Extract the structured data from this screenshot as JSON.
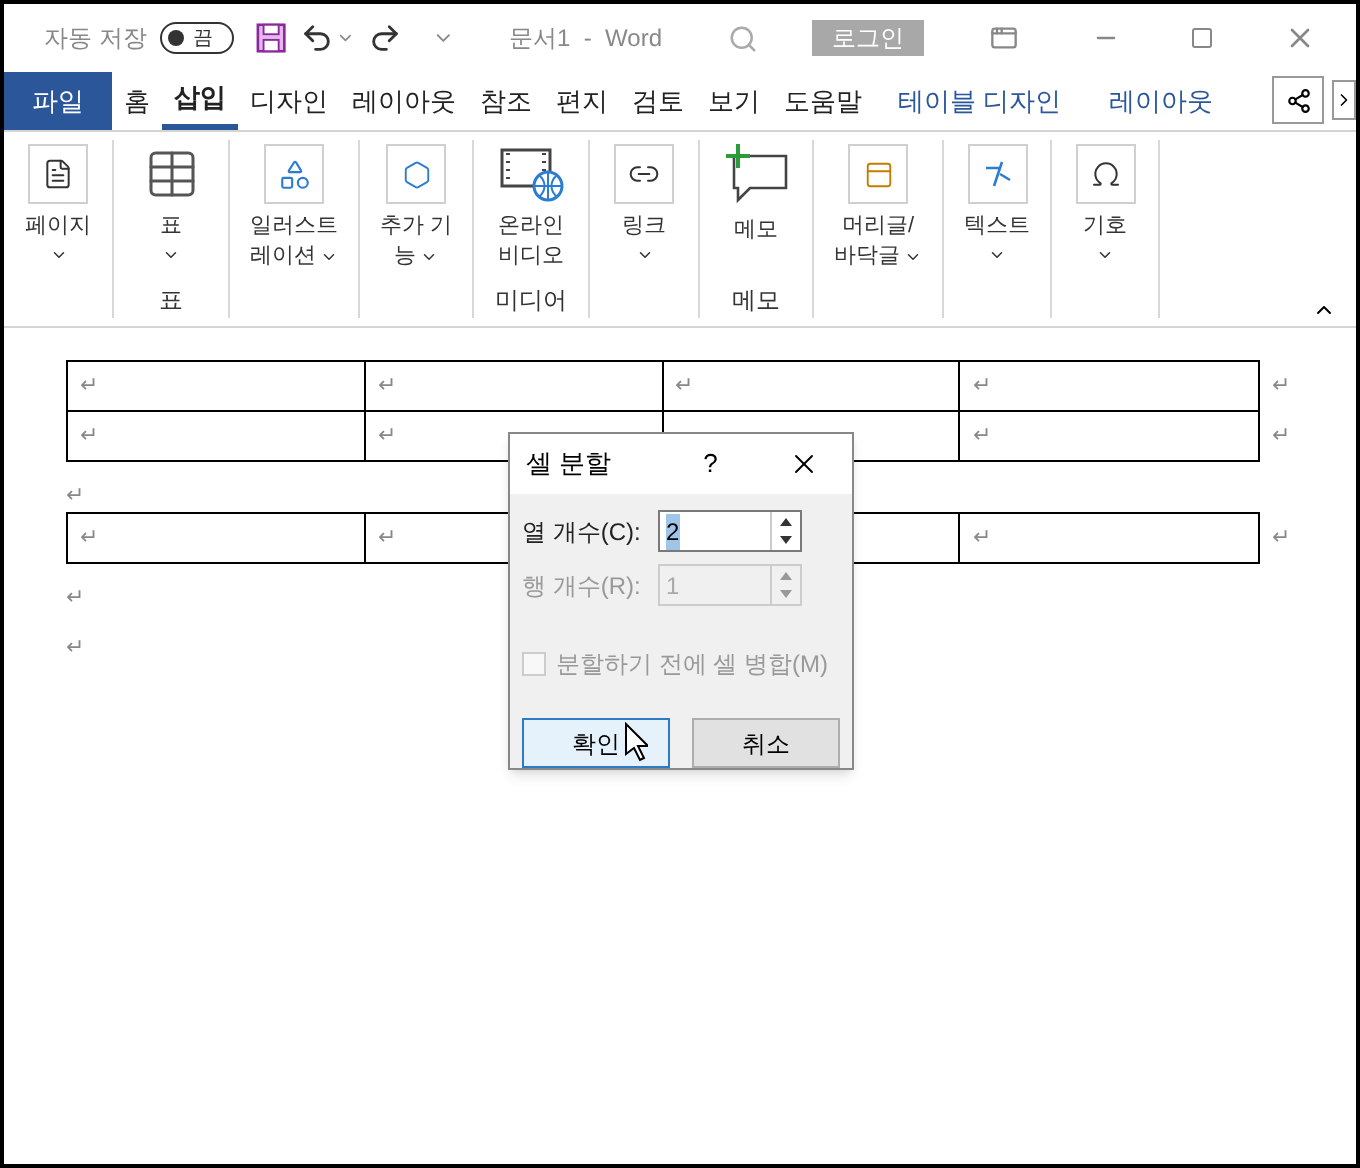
{
  "title_bar": {
    "autosave_label": "자동 저장",
    "autosave_state": "끔",
    "autosave_on": false,
    "document_title": "문서1  -  Word",
    "login_button": "로그인"
  },
  "tabs": [
    {
      "label": "파일",
      "kind": "file",
      "selected": false
    },
    {
      "label": "홈",
      "kind": "normal",
      "selected": false
    },
    {
      "label": "삽입",
      "kind": "normal",
      "selected": true
    },
    {
      "label": "디자인",
      "kind": "normal",
      "selected": false
    },
    {
      "label": "레이아웃",
      "kind": "normal",
      "selected": false
    },
    {
      "label": "참조",
      "kind": "normal",
      "selected": false
    },
    {
      "label": "편지",
      "kind": "normal",
      "selected": false
    },
    {
      "label": "검토",
      "kind": "normal",
      "selected": false
    },
    {
      "label": "보기",
      "kind": "normal",
      "selected": false
    },
    {
      "label": "도움말",
      "kind": "normal",
      "selected": false
    },
    {
      "label": "테이블 디자인",
      "kind": "context",
      "selected": false
    },
    {
      "label": "레이아웃",
      "kind": "context",
      "selected": false
    }
  ],
  "ribbon_groups": [
    {
      "button": {
        "kind": "page",
        "lines": [
          "페이지"
        ],
        "dropdown": true
      }
    },
    {
      "label": "표",
      "button": {
        "kind": "table",
        "lines": [
          "표"
        ],
        "dropdown": true
      }
    },
    {
      "button": {
        "kind": "shapes",
        "lines": [
          "일러스트",
          "레이션"
        ],
        "dropdown": true
      }
    },
    {
      "button": {
        "kind": "addin",
        "lines": [
          "추가 기",
          "능"
        ],
        "dropdown": true
      }
    },
    {
      "label": "미디어",
      "button": {
        "kind": "video",
        "lines": [
          "온라인",
          "비디오"
        ],
        "dropdown": false
      }
    },
    {
      "button": {
        "kind": "link",
        "lines": [
          "링크"
        ],
        "dropdown": true
      }
    },
    {
      "label": "메모",
      "button": {
        "kind": "comment",
        "lines": [
          "메모"
        ],
        "dropdown": false
      }
    },
    {
      "button": {
        "kind": "header",
        "lines": [
          "머리글/",
          "바닥글"
        ],
        "dropdown": true
      }
    },
    {
      "button": {
        "kind": "text",
        "lines": [
          "텍스트"
        ],
        "dropdown": true
      }
    },
    {
      "button": {
        "kind": "symbol",
        "lines": [
          "기호"
        ],
        "dropdown": true
      }
    }
  ],
  "document": {
    "blocks": [
      {
        "kind": "table",
        "rows": [
          {
            "cells": [
              {
                "mark": "↵"
              },
              {
                "mark": "↵"
              },
              {
                "mark": "↵"
              },
              {
                "mark": "↵"
              }
            ],
            "end_mark": "↵"
          },
          {
            "cells": [
              {
                "mark": "↵"
              },
              {
                "mark": "↵"
              },
              {},
              {
                "mark": "↵"
              }
            ],
            "end_mark": "↵"
          }
        ]
      },
      {
        "kind": "paragraph",
        "mark": "↵"
      },
      {
        "kind": "table",
        "rows": [
          {
            "cells": [
              {
                "mark": "↵"
              },
              {
                "mark": "↵"
              },
              {},
              {
                "mark": "↵"
              }
            ],
            "end_mark": "↵"
          }
        ]
      },
      {
        "kind": "paragraph",
        "mark": "↵"
      },
      {
        "kind": "paragraph",
        "mark": "↵"
      }
    ]
  },
  "dialog": {
    "title": "셀 분할",
    "help": "?",
    "fields": [
      {
        "label": "열 개수(C):",
        "value": "2",
        "value_selected": true,
        "disabled": false
      },
      {
        "label": "행 개수(R):",
        "value": "1",
        "value_selected": false,
        "disabled": true
      }
    ],
    "checkbox": {
      "label": "분할하기 전에 셀 병합(M)",
      "checked": false,
      "disabled": true
    },
    "buttons": [
      {
        "label": "확인",
        "focused": true
      },
      {
        "label": "취소",
        "focused": false
      }
    ]
  }
}
